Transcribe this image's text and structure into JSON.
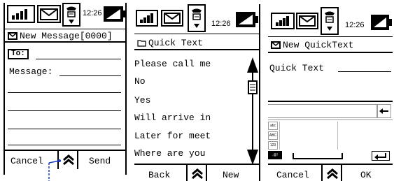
{
  "status": {
    "time": "12:26"
  },
  "screen1": {
    "title": "New Message[0000]",
    "to_label": "To:",
    "message_label": "Message:",
    "left_button": "Cancel",
    "right_button": "Send"
  },
  "screen2": {
    "title": "Quick Text",
    "items": [
      "Please call me",
      "No",
      "Yes",
      "Will arrive in",
      "Later for meet",
      "Where are you"
    ],
    "left_button": "Back",
    "right_button": "New"
  },
  "screen3": {
    "title": "New QuickText",
    "field_label": "Quick Text",
    "kbd_modes": [
      "abc",
      "ABC",
      "123",
      ".@!"
    ],
    "left_button": "Cancel",
    "right_button": "OK"
  },
  "icons": [
    "signal-icon",
    "envelope-icon",
    "telephone-icon",
    "battery-icon",
    "up-chevron-icon",
    "backspace-icon",
    "enter-icon",
    "folder-icon"
  ]
}
